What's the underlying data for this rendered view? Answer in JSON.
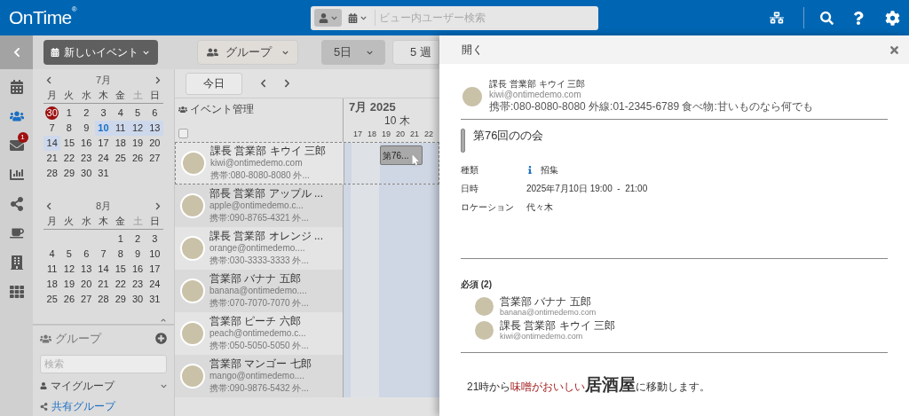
{
  "header": {
    "logo": "OnTime",
    "logo_mark": "®",
    "search": {
      "placeholder": "ビュー内ユーザー検索",
      "filters": [
        {
          "selected": true
        },
        {
          "selected": false
        }
      ]
    }
  },
  "rail": [
    {
      "selected": false
    },
    {
      "selected": true
    },
    {
      "selected": false,
      "badge": "1"
    },
    {
      "selected": false
    },
    {
      "selected": false
    },
    {
      "selected": false
    },
    {
      "selected": false
    },
    {
      "selected": false
    }
  ],
  "toolbar": {
    "new_event": "新しいイベント",
    "group": "グループ",
    "days": "5日",
    "weeks": "5 週"
  },
  "mini_calendars": [
    {
      "month": "7月",
      "weekdays": [
        {
          "label": "月",
          "weekend": false
        },
        {
          "label": "火",
          "weekend": false
        },
        {
          "label": "水",
          "weekend": false
        },
        {
          "label": "木",
          "weekend": false
        },
        {
          "label": "金",
          "weekend": false
        },
        {
          "label": "土",
          "weekend": true
        },
        {
          "label": "日",
          "weekend": false
        }
      ],
      "weeks": [
        [
          {
            "day": "30",
            "today": true,
            "selected": false,
            "current": false
          },
          {
            "day": "1",
            "today": false,
            "selected": false,
            "current": false
          },
          {
            "day": "2",
            "today": false,
            "selected": false,
            "current": false
          },
          {
            "day": "3",
            "today": false,
            "selected": false,
            "current": false
          },
          {
            "day": "4",
            "today": false,
            "selected": false,
            "current": false
          },
          {
            "day": "5",
            "today": false,
            "selected": false,
            "current": false
          },
          {
            "day": "6",
            "today": false,
            "selected": false,
            "current": false
          }
        ],
        [
          {
            "day": "7",
            "today": false,
            "selected": false,
            "current": false
          },
          {
            "day": "8",
            "today": false,
            "selected": false,
            "current": false
          },
          {
            "day": "9",
            "today": false,
            "selected": false,
            "current": false
          },
          {
            "day": "10",
            "today": false,
            "selected": true,
            "current": true
          },
          {
            "day": "11",
            "today": false,
            "selected": true,
            "current": false
          },
          {
            "day": "12",
            "today": false,
            "selected": true,
            "current": false
          },
          {
            "day": "13",
            "today": false,
            "selected": true,
            "current": false
          }
        ],
        [
          {
            "day": "14",
            "today": false,
            "selected": true,
            "current": false
          },
          {
            "day": "15",
            "today": false,
            "selected": false,
            "current": false
          },
          {
            "day": "16",
            "today": false,
            "selected": false,
            "current": false
          },
          {
            "day": "17",
            "today": false,
            "selected": false,
            "current": false
          },
          {
            "day": "18",
            "today": false,
            "selected": false,
            "current": false
          },
          {
            "day": "19",
            "today": false,
            "selected": false,
            "current": false
          },
          {
            "day": "20",
            "today": false,
            "selected": false,
            "current": false
          }
        ],
        [
          {
            "day": "21",
            "today": false,
            "selected": false,
            "current": false
          },
          {
            "day": "22",
            "today": false,
            "selected": false,
            "current": false
          },
          {
            "day": "23",
            "today": false,
            "selected": false,
            "current": false
          },
          {
            "day": "24",
            "today": false,
            "selected": false,
            "current": false
          },
          {
            "day": "25",
            "today": false,
            "selected": false,
            "current": false
          },
          {
            "day": "26",
            "today": false,
            "selected": false,
            "current": false
          },
          {
            "day": "27",
            "today": false,
            "selected": false,
            "current": false
          }
        ],
        {
          "kind": "closing",
          "days": [
            {
              "day": "28",
              "today": false,
              "selected": false,
              "current": false
            },
            {
              "day": "29",
              "today": false,
              "selected": false,
              "current": false
            },
            {
              "day": "30",
              "today": false,
              "selected": false,
              "current": false
            },
            {
              "day": "31",
              "today": false,
              "selected": false,
              "current": false
            }
          ]
        }
      ]
    },
    {
      "month": "8月",
      "weekdays": [
        {
          "label": "月",
          "weekend": false
        },
        {
          "label": "火",
          "weekend": false
        },
        {
          "label": "水",
          "weekend": false
        },
        {
          "label": "木",
          "weekend": false
        },
        {
          "label": "金",
          "weekend": false
        },
        {
          "label": "土",
          "weekend": true
        },
        {
          "label": "日",
          "weekend": false
        }
      ],
      "weeks": [
        {
          "kind": "opening",
          "days": [
            "1",
            "2",
            "3"
          ]
        },
        [
          "4",
          "5",
          "6",
          "7",
          "8",
          "9",
          "10"
        ],
        [
          "11",
          "12",
          "13",
          "14",
          "15",
          "16",
          "17"
        ],
        [
          "18",
          "19",
          "20",
          "21",
          "22",
          "23",
          "24"
        ],
        [
          "25",
          "26",
          "27",
          "28",
          "29",
          "30",
          "31"
        ]
      ]
    }
  ],
  "groups": {
    "title": "グループ",
    "search_placeholder": "検索",
    "items": [
      {
        "label": "マイグループ",
        "kind": "personal"
      },
      {
        "label": "共有グループ",
        "kind": "shared"
      }
    ]
  },
  "nav": {
    "today": "今日"
  },
  "timeline": {
    "list_title": "イベント管理",
    "select_all": {
      "checked": false
    },
    "month": "7月 2025",
    "date": "10 木",
    "hours": [
      "17",
      "18",
      "19",
      "20",
      "21",
      "22"
    ]
  },
  "people": [
    {
      "name": "課長 営業部 キウイ 三郎",
      "email": "kiwi@ontimedemo.com",
      "phone": "携帯:080-8080-8080 外...",
      "selected": true,
      "event": "第76..."
    },
    {
      "name": "部長 営業部 アップル ...",
      "email": "apple@ontimedemo.c...",
      "phone": "携帯:090-8765-4321 外...",
      "selected": false
    },
    {
      "name": "課長 営業部 オレンジ ...",
      "email": "orange@ontimedemo....",
      "phone": "携帯:030-3333-3333 外...",
      "selected": false
    },
    {
      "name": "営業部 バナナ 五郎",
      "email": "banana@ontimedemo....",
      "phone": "携帯:070-7070-7070 外...",
      "selected": false
    },
    {
      "name": "営業部 ピーチ 六郎",
      "email": "peach@ontimedemo.c...",
      "phone": "携帯:050-5050-5050 外...",
      "selected": false
    },
    {
      "name": "営業部 マンゴー 七郎",
      "email": "mango@ontimedemo....",
      "phone": "携帯:090-9876-5432 外...",
      "selected": false
    }
  ],
  "panel": {
    "title": "開く",
    "organizer": {
      "name": "課長 営業部 キウイ 三郎",
      "email": "kiwi@ontimedemo.com",
      "info": "携帯:080-8080-8080 外線:01-2345-6789 食べ物:甘いものなら何でも"
    },
    "event_title": "第76回のの会",
    "fields": [
      {
        "label": "種類",
        "value": "招集",
        "kind": "info"
      },
      {
        "label": "日時",
        "value": "2025年7月10日 19:00  -  21:00",
        "kind": "text"
      },
      {
        "label": "ロケーション",
        "value": "代々木",
        "kind": "text"
      }
    ],
    "required": {
      "heading": "必須 (2)",
      "people": [
        {
          "name": "営業部 バナナ 五郎",
          "email": "banana@ontimedemo.com"
        },
        {
          "name": "課長 営業部 キウイ 三郎",
          "email": "kiwi@ontimedemo.com"
        }
      ]
    },
    "description": [
      {
        "text": "21時から",
        "kind": "plain"
      },
      {
        "text": "味噌がおいしい",
        "kind": "accent"
      },
      {
        "text": "居酒屋",
        "kind": "large"
      },
      {
        "text": "に移動します。",
        "kind": "plain"
      }
    ]
  }
}
